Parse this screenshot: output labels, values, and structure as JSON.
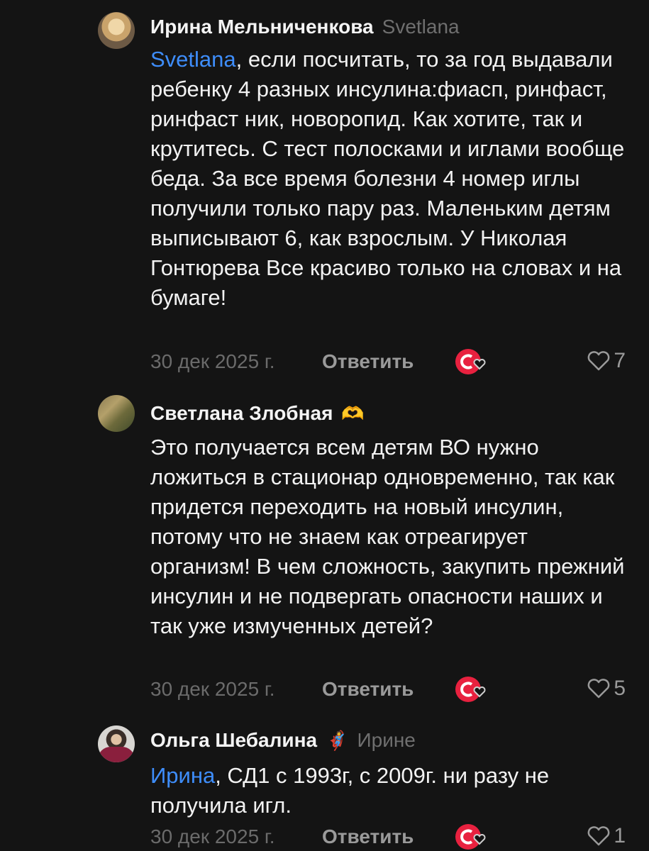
{
  "comments": [
    {
      "author": "Ирина Мельниченкова",
      "reply_to": "Svetlana",
      "mention": "Svetlana",
      "text_after_mention": ", если посчитать, то за год выдавали ребенку 4 разных инсулина:фиасп, ринфаст, ринфаст ник, новоропид. Как хотите, так и крутитесь. С тест полосками и иглами вообще беда. За все время болезни 4 номер иглы получили только пару раз. Маленьким детям выписывают 6, как взрослым. У Николая Гонтюрева Все красиво только на словах и на бумаге!",
      "date": "30 дек 2025 г.",
      "reply_label": "Ответить",
      "likes": "7"
    },
    {
      "author": "Светлана Злобная",
      "author_emoji": "🫶",
      "text": "Это получается всем детям ВО нужно ложиться в стационар одновременно, так как придется переходить на новый инсулин, потому что не знаем как отреагирует организм! В чем сложность, закупить прежний инсулин и не подвергать опасности наших и так уже измученных детей?",
      "date": "30 дек 2025 г.",
      "reply_label": "Ответить",
      "likes": "5"
    },
    {
      "author": "Ольга Шебалина",
      "author_emoji": "🦸",
      "reply_to": "Ирине",
      "mention": "Ирина",
      "text_after_mention": ", СД1 с 1993г, с 2009г. ни разу не получила игл.",
      "date": "30 дек 2025 г.",
      "reply_label": "Ответить",
      "likes": "1"
    }
  ],
  "colors": {
    "background": "#141414",
    "mention": "#3e8dfa",
    "muted": "#6b6b6b",
    "badge_red": "#e8213f"
  },
  "icons": {
    "reaction_badge": "red-circle-heart-badge-icon",
    "like": "heart-outline-icon"
  }
}
